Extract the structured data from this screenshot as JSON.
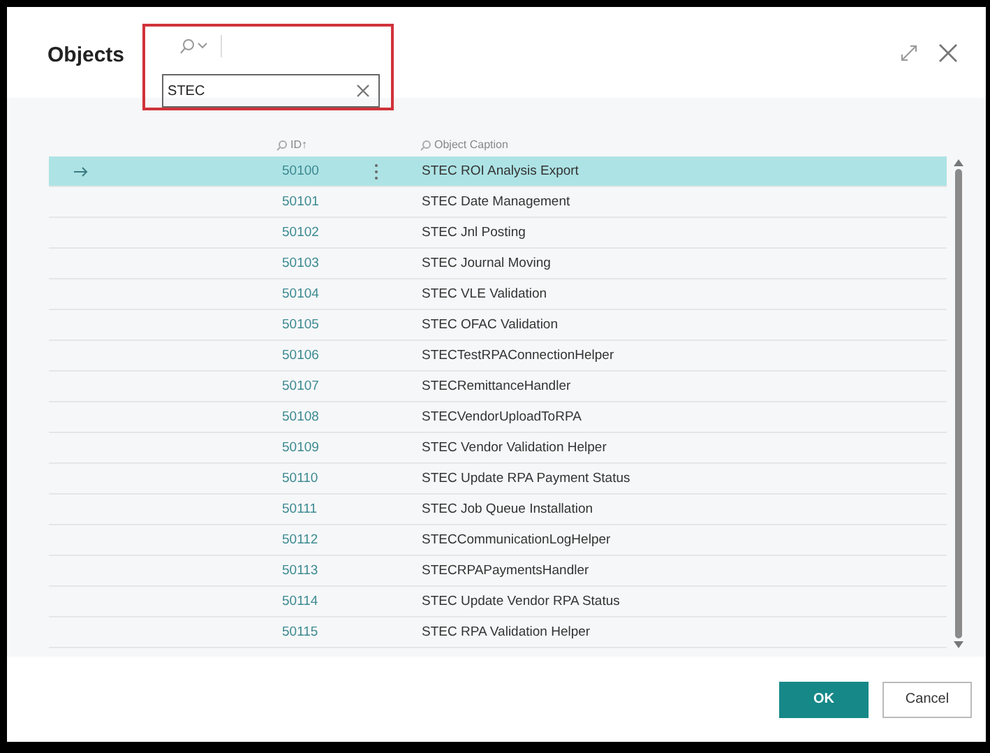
{
  "window": {
    "title": "Objects"
  },
  "search": {
    "value": "STEC",
    "highlighted": true
  },
  "columns": [
    {
      "label": "ID",
      "sort": "↑"
    },
    {
      "label": "Object Caption"
    }
  ],
  "rows": [
    {
      "id": "50100",
      "caption": "STEC ROI Analysis Export",
      "selected": true
    },
    {
      "id": "50101",
      "caption": "STEC Date Management",
      "selected": false
    },
    {
      "id": "50102",
      "caption": "STEC Jnl Posting",
      "selected": false
    },
    {
      "id": "50103",
      "caption": "STEC Journal Moving",
      "selected": false
    },
    {
      "id": "50104",
      "caption": "STEC VLE Validation",
      "selected": false
    },
    {
      "id": "50105",
      "caption": "STEC OFAC Validation",
      "selected": false
    },
    {
      "id": "50106",
      "caption": "STECTestRPAConnectionHelper",
      "selected": false
    },
    {
      "id": "50107",
      "caption": "STECRemittanceHandler",
      "selected": false
    },
    {
      "id": "50108",
      "caption": "STECVendorUploadToRPA",
      "selected": false
    },
    {
      "id": "50109",
      "caption": "STEC Vendor Validation Helper",
      "selected": false
    },
    {
      "id": "50110",
      "caption": "STEC Update RPA Payment Status",
      "selected": false
    },
    {
      "id": "50111",
      "caption": "STEC Job Queue Installation",
      "selected": false
    },
    {
      "id": "50112",
      "caption": "STECCommunicationLogHelper",
      "selected": false
    },
    {
      "id": "50113",
      "caption": "STECRPAPaymentsHandler",
      "selected": false
    },
    {
      "id": "50114",
      "caption": "STEC Update Vendor RPA Status",
      "selected": false
    },
    {
      "id": "50115",
      "caption": "STEC RPA Validation Helper",
      "selected": false
    }
  ],
  "buttons": [
    {
      "label": "OK",
      "kind": "primary"
    },
    {
      "label": "Cancel",
      "kind": "secondary"
    }
  ]
}
